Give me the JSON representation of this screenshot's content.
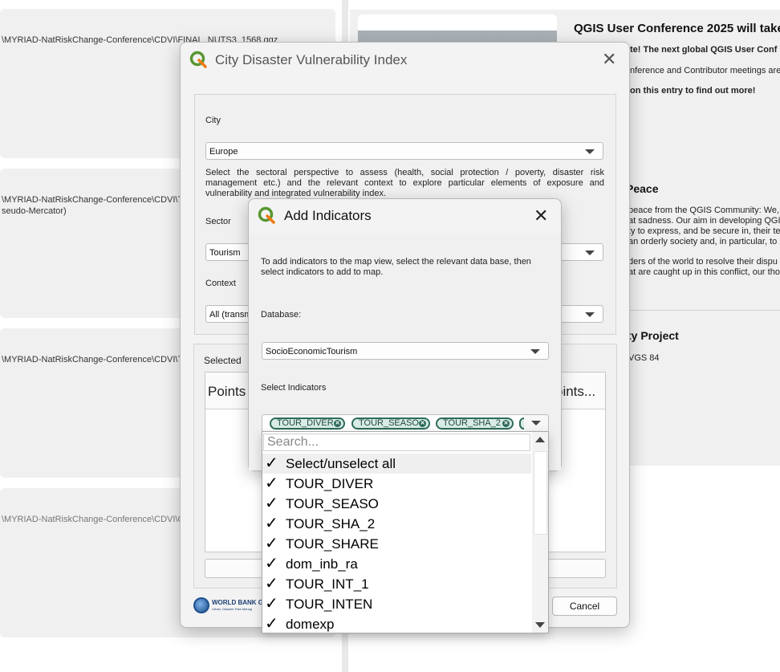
{
  "background": {
    "recent_projects": [
      {
        "path": "\\MYRIAD-NatRiskChange-Conference\\CDVI\\FINAL_NUTS3_1568.qgz",
        "sub": ""
      },
      {
        "path": "\\MYRIAD-NatRiskChange-Conference\\CDVI\\To",
        "sub": "seudo-Mercator)"
      },
      {
        "path": "\\MYRIAD-NatRiskChange-Conference\\CDVI\\TE",
        "sub": ""
      },
      {
        "path": "\\MYRIAD-NatRiskChange-Conference\\CDVI\\CD",
        "sub": ""
      }
    ],
    "news": {
      "item1_title": "QGIS User Conference 2025 will take",
      "item1_line1": "te! The next global QGIS User Conf",
      "item1_line2": "nference and Contributor meetings are t",
      "item1_line3": "on this entry to find out more!",
      "item2_title": "Peace",
      "item2_lines": [
        "peace from the QGIS Community: We, t",
        "at sadness. Our aim in developing QGIS",
        "ty to express, and be secure in, their te",
        "an orderly society and, in particular, to",
        "",
        "ders of the world to resolve their dispu",
        "at are caught up in this conflict, our thou"
      ],
      "item3_title": "ty Project",
      "item3_line1": "VGS 84"
    }
  },
  "main_dialog": {
    "title": "City Disaster Vulnerability Index",
    "city_label": "City",
    "city_value": "Europe",
    "description": "Select the sectoral perspective to assess (health, social protection / poverty, disaster risk management etc.) and the relevant context to explore particular elements of exposure and vulnerability and integrated vulnerability index.",
    "sector_label": "Sector",
    "sector_value": "Tourism",
    "context_label": "Context",
    "context_value": "All (transm",
    "selected_label": "Selected",
    "selected_col1": "Points",
    "selected_col2": "oints...",
    "cancel_label": "Cancel",
    "logo_text": "WORLD BANK G",
    "logo_sub": "Urban, Disaster Risk Manag"
  },
  "add_dialog": {
    "title": "Add Indicators",
    "instructions": "To add indicators to the map view, select the relevant data base, then select indicators to add to map.",
    "database_label": "Database:",
    "database_value": "SocioEconomicTourism",
    "select_label": "Select Indicators",
    "tags": [
      "TOUR_DIVER",
      "TOUR_SEASO",
      "TOUR_SHA_2"
    ]
  },
  "dropdown": {
    "search_placeholder": "Search...",
    "check_glyph": "✓",
    "options": [
      {
        "label": "Select/unselect all",
        "checked": true
      },
      {
        "label": "TOUR_DIVER",
        "checked": true
      },
      {
        "label": "TOUR_SEASO",
        "checked": true
      },
      {
        "label": "TOUR_SHA_2",
        "checked": true
      },
      {
        "label": "TOUR_SHARE",
        "checked": true
      },
      {
        "label": "dom_inb_ra",
        "checked": true
      },
      {
        "label": "TOUR_INT_1",
        "checked": true
      },
      {
        "label": "TOUR_INTEN",
        "checked": true
      },
      {
        "label": "domexp",
        "checked": true
      }
    ]
  },
  "colors": {
    "qgis_green": "#589632",
    "qgis_yellow": "#ee7913",
    "tag_border": "#2e6b5c"
  }
}
